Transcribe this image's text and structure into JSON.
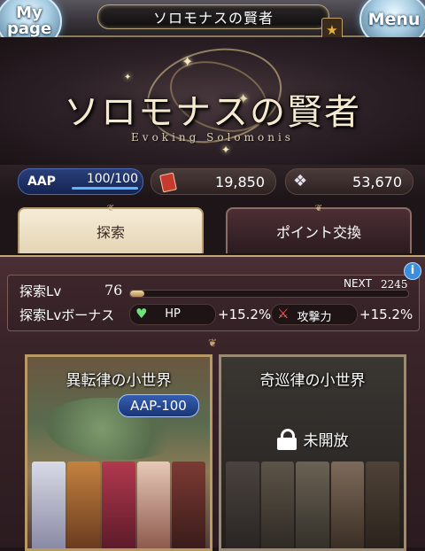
{
  "header": {
    "title": "ソロモナスの賢者",
    "mypage_label_1": "My",
    "mypage_label_2": "page",
    "menu_label": "Menu"
  },
  "banner": {
    "title": "ソロモナスの賢者",
    "subtitle": "Evoking Solomonis"
  },
  "stats": {
    "aap_label": "AAP",
    "aap_value": "100/100",
    "aap_fraction": 1.0,
    "ticket_count": "19,850",
    "crystal_count": "53,670"
  },
  "tabs": [
    {
      "label": "探索"
    },
    {
      "label": "ポイント交換"
    }
  ],
  "level": {
    "label": "探索Lv",
    "value": "76",
    "next_label": "NEXT",
    "next_value": "2245",
    "progress_fraction": 0.05,
    "bonus_label": "探索Lvボーナス",
    "bonuses": [
      {
        "name": "HP",
        "value": "+15.2%"
      },
      {
        "name": "攻撃力",
        "value": "+15.2%"
      }
    ]
  },
  "worlds": [
    {
      "name": "異転律の小世界",
      "cost": "AAP-100",
      "locked": false
    },
    {
      "name": "奇巡律の小世界",
      "status": "未開放",
      "locked": true
    }
  ]
}
